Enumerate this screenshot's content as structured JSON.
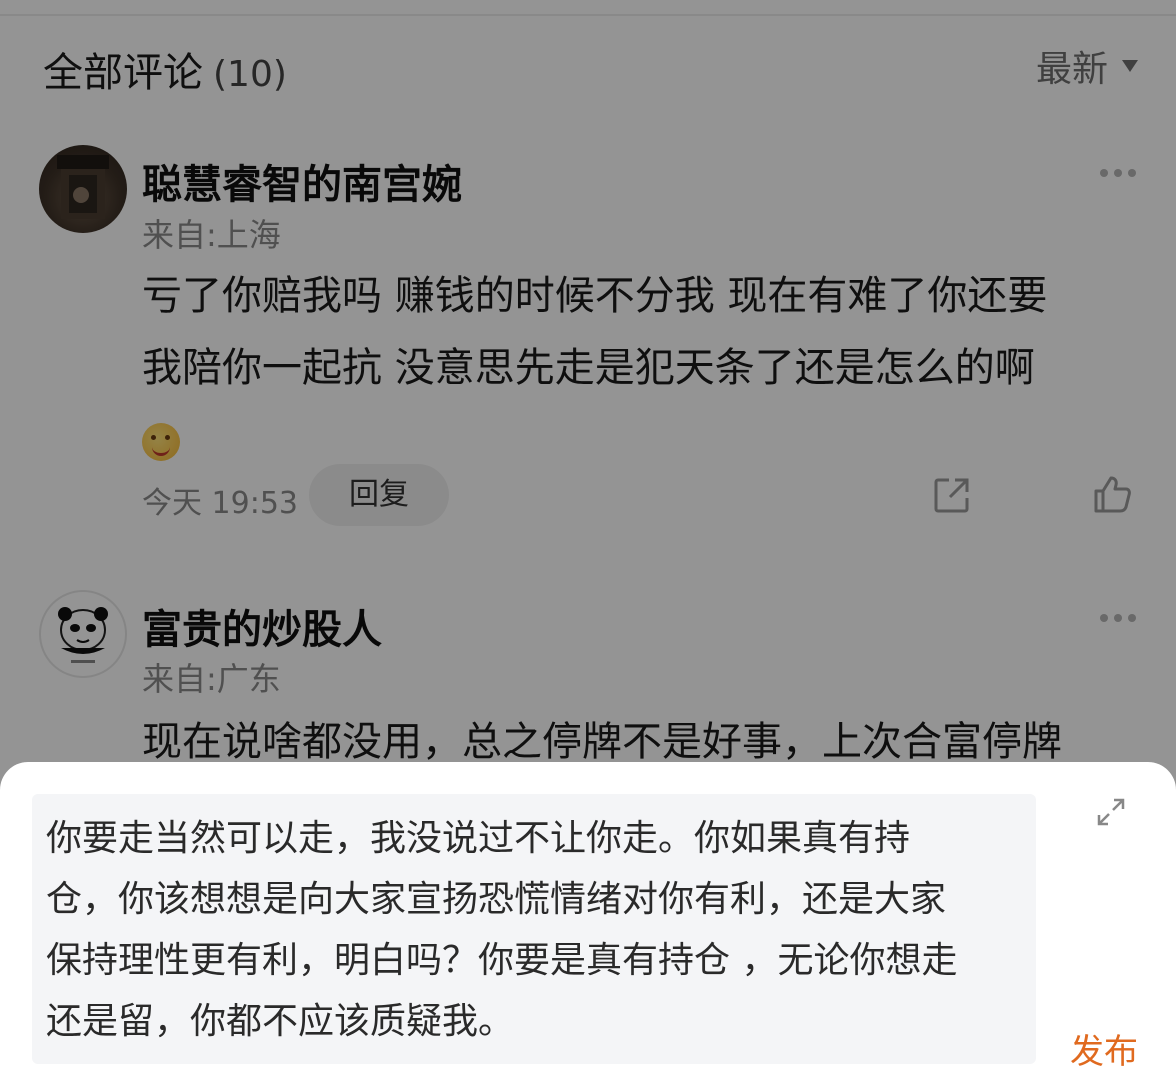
{
  "header": {
    "title": "全部评论",
    "count": "(10)",
    "sort_label": "最新"
  },
  "comments": [
    {
      "username": "聪慧睿智的南宫婉",
      "location": "来自:上海",
      "lines": [
        "亏了你赔我吗 赚钱的时候不分我 现在有难了你还要",
        "我陪你一起抗 没意思先走是犯天条了还是怎么的啊"
      ],
      "emoji": "smiling-face-emoji",
      "time": "今天 19:53",
      "reply_label": "回复"
    },
    {
      "username": "富贵的炒股人",
      "location": "来自:广东",
      "lines": [
        "现在说啥都没用，总之停牌不是好事，上次合富停牌"
      ]
    }
  ],
  "composer": {
    "lines": [
      "你要走当然可以走，我没说过不让你走。你如果真有持",
      "仓，你该想想是向大家宣扬恐慌情绪对你有利，还是大家",
      "保持理性更有利，明白吗？你要是真有持仓 ，无论你想走",
      "还是留，你都不应该质疑我。"
    ],
    "publish_label": "发布"
  },
  "colors": {
    "accent": "#e06a1f",
    "dim_overlay": "rgba(0,0,0,0.42)"
  }
}
